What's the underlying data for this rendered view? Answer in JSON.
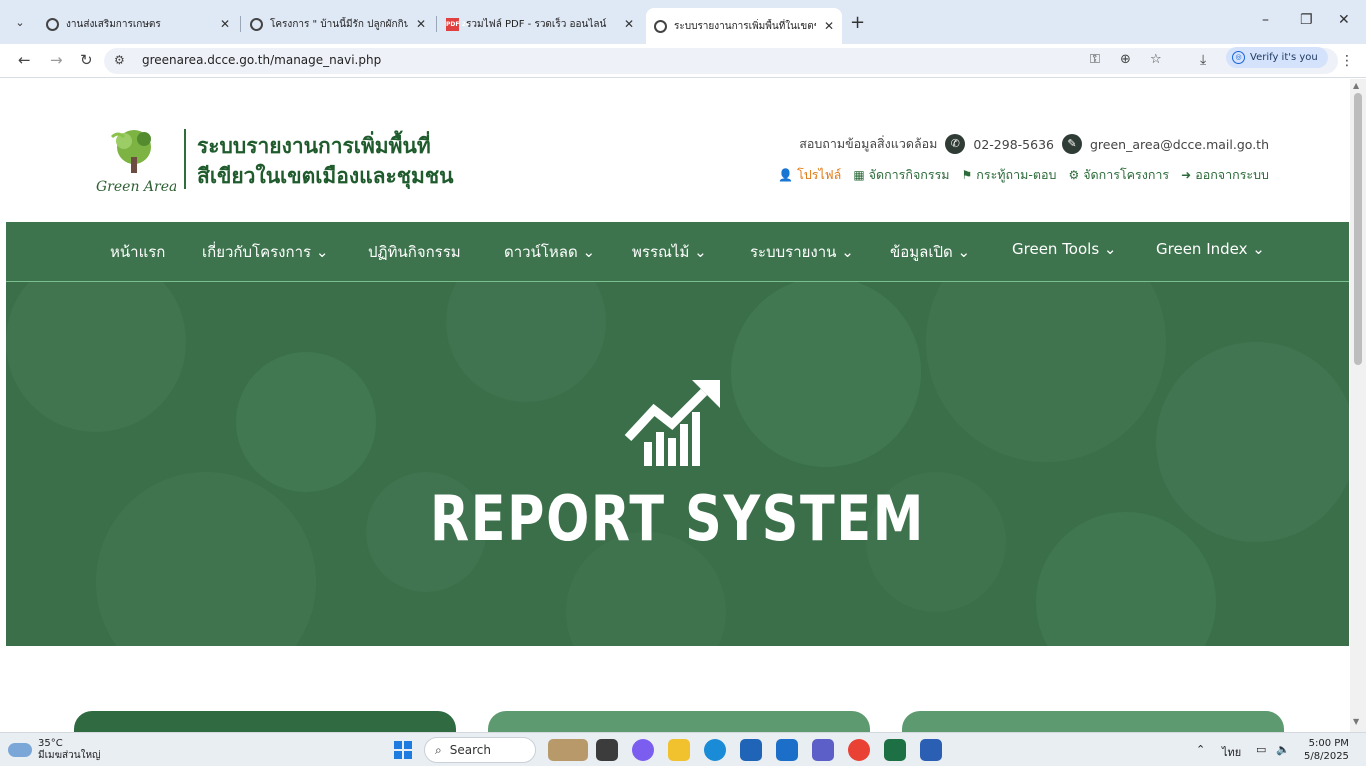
{
  "browser": {
    "tabs": [
      {
        "title": "งานส่งเสริมการเกษตร",
        "active": false
      },
      {
        "title": "โครงการ \" บ้านนี้มีรัก ปลูกผักกินเอง",
        "active": false
      },
      {
        "title": "รวมไฟล์ PDF - รวดเร็ว ออนไลน์",
        "active": false
      },
      {
        "title": "ระบบรายงานการเพิ่มพื้นที่ในเขตชุมช",
        "active": true
      }
    ],
    "pdf_badge": "PDF 24",
    "new_tab_label": "+",
    "close_label": "✕",
    "url": "greenarea.dcce.go.th/manage_navi.php",
    "verify_label": "Verify it's you"
  },
  "site": {
    "logo_text": "Green Area",
    "title_line1": "ระบบรายงานการเพิ่มพื้นที่",
    "title_line2": "สีเขียวในเขตเมืองและชุมชน",
    "contact_label": "สอบถามข้อมูลสิ่งแวดล้อม",
    "phone": "02-298-5636",
    "email": "green_area@dcce.mail.go.th",
    "user_menu": [
      {
        "label": "โปรไฟล์",
        "icon": "user-icon"
      },
      {
        "label": "จัดการกิจกรรม",
        "icon": "calendar-icon"
      },
      {
        "label": "กระทู้ถาม-ตอบ",
        "icon": "flag-icon"
      },
      {
        "label": "จัดการโครงการ",
        "icon": "gear-icon"
      },
      {
        "label": "ออกจากระบบ",
        "icon": "logout-icon"
      }
    ]
  },
  "nav": [
    {
      "label": "หน้าแรก"
    },
    {
      "label": "เกี่ยวกับโครงการ ⌄"
    },
    {
      "label": "ปฏิทินกิจกรรม"
    },
    {
      "label": "ดาวน์โหลด ⌄"
    },
    {
      "label": "พรรณไม้ ⌄"
    },
    {
      "label": "ระบบรายงาน ⌄"
    },
    {
      "label": "ข้อมูลเปิด ⌄"
    },
    {
      "label": "Green Tools ⌄"
    },
    {
      "label": "Green Index ⌄"
    }
  ],
  "hero": {
    "title": "REPORT SYSTEM",
    "icon": "growth-chart-icon"
  },
  "taskbar": {
    "temperature": "35°C",
    "weather_desc": "มีเมฆส่วนใหญ่",
    "search_placeholder": "Search",
    "language": "ไทย",
    "time": "5:00 PM",
    "date": "5/8/2025"
  },
  "colors": {
    "nav_green": "#3d744d",
    "title_green": "#1f5b2c",
    "profile_orange": "#e07b15"
  }
}
